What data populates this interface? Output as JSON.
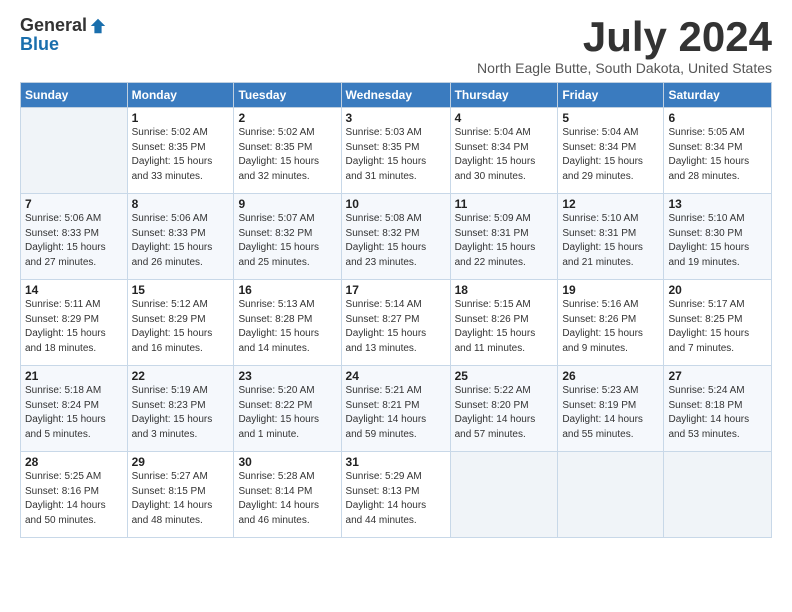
{
  "logo": {
    "general": "General",
    "blue": "Blue"
  },
  "header": {
    "month": "July 2024",
    "location": "North Eagle Butte, South Dakota, United States"
  },
  "weekdays": [
    "Sunday",
    "Monday",
    "Tuesday",
    "Wednesday",
    "Thursday",
    "Friday",
    "Saturday"
  ],
  "weeks": [
    [
      {
        "day": "",
        "info": ""
      },
      {
        "day": "1",
        "info": "Sunrise: 5:02 AM\nSunset: 8:35 PM\nDaylight: 15 hours\nand 33 minutes."
      },
      {
        "day": "2",
        "info": "Sunrise: 5:02 AM\nSunset: 8:35 PM\nDaylight: 15 hours\nand 32 minutes."
      },
      {
        "day": "3",
        "info": "Sunrise: 5:03 AM\nSunset: 8:35 PM\nDaylight: 15 hours\nand 31 minutes."
      },
      {
        "day": "4",
        "info": "Sunrise: 5:04 AM\nSunset: 8:34 PM\nDaylight: 15 hours\nand 30 minutes."
      },
      {
        "day": "5",
        "info": "Sunrise: 5:04 AM\nSunset: 8:34 PM\nDaylight: 15 hours\nand 29 minutes."
      },
      {
        "day": "6",
        "info": "Sunrise: 5:05 AM\nSunset: 8:34 PM\nDaylight: 15 hours\nand 28 minutes."
      }
    ],
    [
      {
        "day": "7",
        "info": "Sunrise: 5:06 AM\nSunset: 8:33 PM\nDaylight: 15 hours\nand 27 minutes."
      },
      {
        "day": "8",
        "info": "Sunrise: 5:06 AM\nSunset: 8:33 PM\nDaylight: 15 hours\nand 26 minutes."
      },
      {
        "day": "9",
        "info": "Sunrise: 5:07 AM\nSunset: 8:32 PM\nDaylight: 15 hours\nand 25 minutes."
      },
      {
        "day": "10",
        "info": "Sunrise: 5:08 AM\nSunset: 8:32 PM\nDaylight: 15 hours\nand 23 minutes."
      },
      {
        "day": "11",
        "info": "Sunrise: 5:09 AM\nSunset: 8:31 PM\nDaylight: 15 hours\nand 22 minutes."
      },
      {
        "day": "12",
        "info": "Sunrise: 5:10 AM\nSunset: 8:31 PM\nDaylight: 15 hours\nand 21 minutes."
      },
      {
        "day": "13",
        "info": "Sunrise: 5:10 AM\nSunset: 8:30 PM\nDaylight: 15 hours\nand 19 minutes."
      }
    ],
    [
      {
        "day": "14",
        "info": "Sunrise: 5:11 AM\nSunset: 8:29 PM\nDaylight: 15 hours\nand 18 minutes."
      },
      {
        "day": "15",
        "info": "Sunrise: 5:12 AM\nSunset: 8:29 PM\nDaylight: 15 hours\nand 16 minutes."
      },
      {
        "day": "16",
        "info": "Sunrise: 5:13 AM\nSunset: 8:28 PM\nDaylight: 15 hours\nand 14 minutes."
      },
      {
        "day": "17",
        "info": "Sunrise: 5:14 AM\nSunset: 8:27 PM\nDaylight: 15 hours\nand 13 minutes."
      },
      {
        "day": "18",
        "info": "Sunrise: 5:15 AM\nSunset: 8:26 PM\nDaylight: 15 hours\nand 11 minutes."
      },
      {
        "day": "19",
        "info": "Sunrise: 5:16 AM\nSunset: 8:26 PM\nDaylight: 15 hours\nand 9 minutes."
      },
      {
        "day": "20",
        "info": "Sunrise: 5:17 AM\nSunset: 8:25 PM\nDaylight: 15 hours\nand 7 minutes."
      }
    ],
    [
      {
        "day": "21",
        "info": "Sunrise: 5:18 AM\nSunset: 8:24 PM\nDaylight: 15 hours\nand 5 minutes."
      },
      {
        "day": "22",
        "info": "Sunrise: 5:19 AM\nSunset: 8:23 PM\nDaylight: 15 hours\nand 3 minutes."
      },
      {
        "day": "23",
        "info": "Sunrise: 5:20 AM\nSunset: 8:22 PM\nDaylight: 15 hours\nand 1 minute."
      },
      {
        "day": "24",
        "info": "Sunrise: 5:21 AM\nSunset: 8:21 PM\nDaylight: 14 hours\nand 59 minutes."
      },
      {
        "day": "25",
        "info": "Sunrise: 5:22 AM\nSunset: 8:20 PM\nDaylight: 14 hours\nand 57 minutes."
      },
      {
        "day": "26",
        "info": "Sunrise: 5:23 AM\nSunset: 8:19 PM\nDaylight: 14 hours\nand 55 minutes."
      },
      {
        "day": "27",
        "info": "Sunrise: 5:24 AM\nSunset: 8:18 PM\nDaylight: 14 hours\nand 53 minutes."
      }
    ],
    [
      {
        "day": "28",
        "info": "Sunrise: 5:25 AM\nSunset: 8:16 PM\nDaylight: 14 hours\nand 50 minutes."
      },
      {
        "day": "29",
        "info": "Sunrise: 5:27 AM\nSunset: 8:15 PM\nDaylight: 14 hours\nand 48 minutes."
      },
      {
        "day": "30",
        "info": "Sunrise: 5:28 AM\nSunset: 8:14 PM\nDaylight: 14 hours\nand 46 minutes."
      },
      {
        "day": "31",
        "info": "Sunrise: 5:29 AM\nSunset: 8:13 PM\nDaylight: 14 hours\nand 44 minutes."
      },
      {
        "day": "",
        "info": ""
      },
      {
        "day": "",
        "info": ""
      },
      {
        "day": "",
        "info": ""
      }
    ]
  ]
}
